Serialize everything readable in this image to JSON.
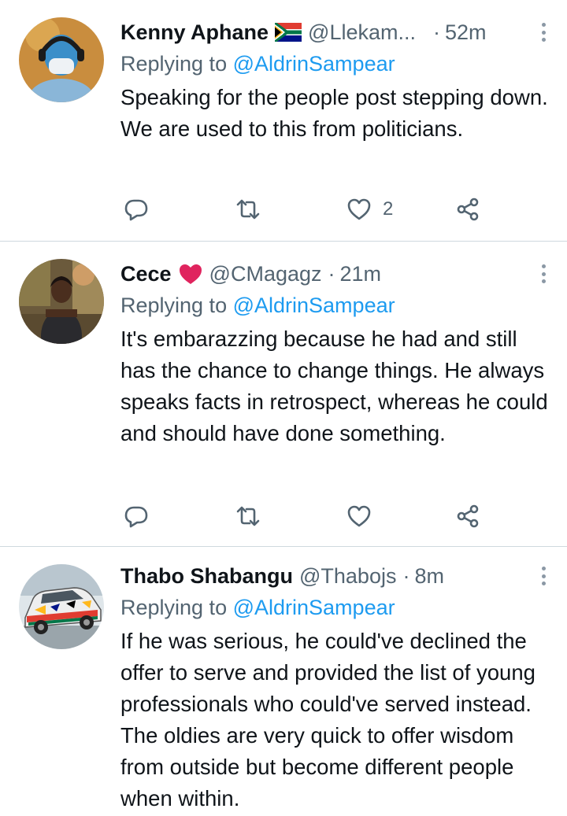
{
  "tweets": [
    {
      "name": "Kenny Aphane",
      "flag": "south-africa-flag",
      "handle": "@Llekam...",
      "separator": "·",
      "time": "52m",
      "replying_prefix": "Replying to ",
      "replying_to": "@AldrinSampear",
      "text": "Speaking for the people post stepping down. We are used to this from politicians.",
      "like_count": "2"
    },
    {
      "name": "Cece",
      "emoji": "red-heart",
      "handle": "@CMagagz",
      "separator": "·",
      "time": "21m",
      "replying_prefix": "Replying to ",
      "replying_to": "@AldrinSampear",
      "text": "It's embarazzing because he had and still has the chance to change things. He always speaks facts in retrospect, whereas he could and should have done something.",
      "like_count": ""
    },
    {
      "name": "Thabo Shabangu",
      "handle": "@Thabojs",
      "separator": "·",
      "time": "8m",
      "replying_prefix": "Replying to ",
      "replying_to": "@AldrinSampear",
      "text": "If he was serious,  he could've declined the offer to serve and provided the list of young professionals who could've served instead. The oldies are very quick to offer wisdom from outside but become different people when within.",
      "like_count": ""
    }
  ],
  "icons": {
    "reply": "reply-icon",
    "retweet": "retweet-icon",
    "like": "heart-icon",
    "share": "share-icon",
    "more": "more-options-icon"
  },
  "colors": {
    "text": "#0f1419",
    "secondary": "#536471",
    "mention": "#1d9bf0",
    "divider": "#cfd9de",
    "heart_emoji": "#e0245e"
  }
}
